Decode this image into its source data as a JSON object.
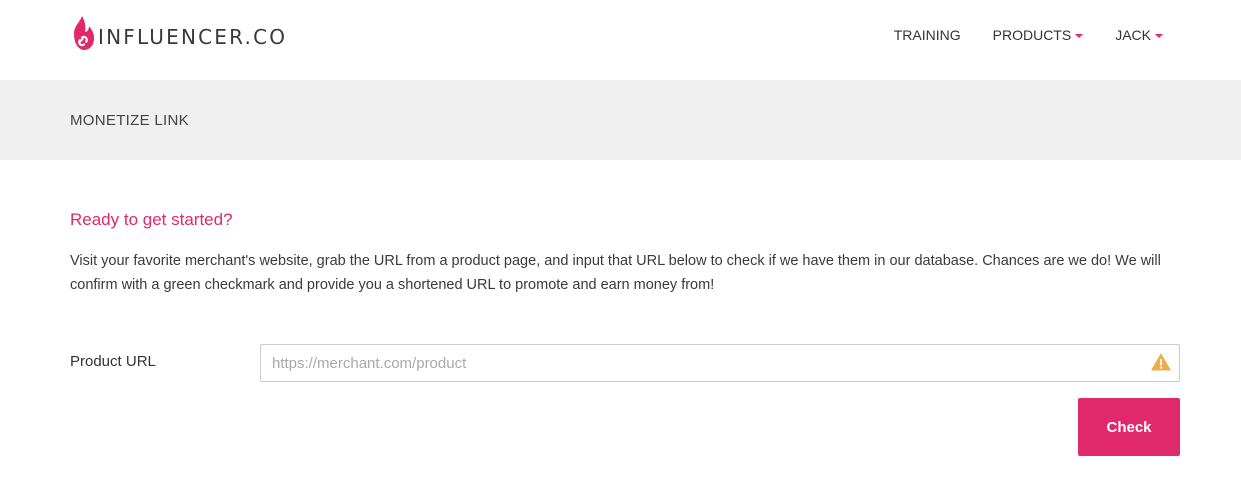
{
  "brand": {
    "name": "INFLUENCER.CO",
    "accent": "#e0286b",
    "logo_icon": "flame-link-icon"
  },
  "nav": {
    "items": [
      {
        "label": "TRAINING",
        "dropdown": false
      },
      {
        "label": "PRODUCTS",
        "dropdown": true
      },
      {
        "label": "JACK",
        "dropdown": true
      }
    ]
  },
  "page": {
    "title": "MONETIZE LINK"
  },
  "content": {
    "heading": "Ready to get started?",
    "intro": "Visit your favorite merchant's website, grab the URL from a product page, and input that URL below to check if we have them in our database. Chances are we do! We will confirm with a green checkmark and provide you a shortened URL to promote and earn money from!"
  },
  "form": {
    "product_url": {
      "label": "Product URL",
      "placeholder": "https://merchant.com/product",
      "value": "",
      "status_icon": "warning-icon",
      "status_color": "#f0ad4e"
    },
    "check_label": "Check"
  }
}
